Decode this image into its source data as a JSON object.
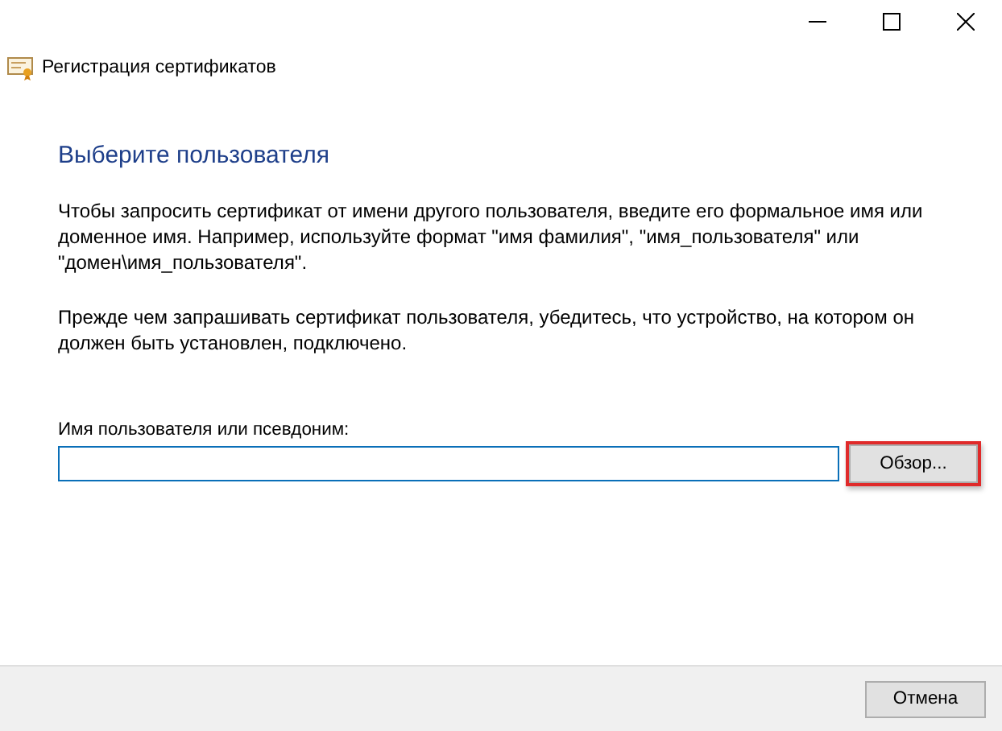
{
  "window": {
    "title": "Регистрация сертификатов"
  },
  "heading": "Выберите пользователя",
  "paragraphs": [
    "Чтобы запросить сертификат от имени другого пользователя, введите его формальное имя или доменное имя. Например, используйте формат \"имя фамилия\", \"имя_пользователя\" или \"домен\\имя_пользователя\".",
    "Прежде чем запрашивать сертификат пользователя, убедитесь, что устройство, на котором он должен быть установлен, подключено."
  ],
  "user_field": {
    "label": "Имя пользователя или псевдоним:",
    "focused": true
  },
  "browse_button": {
    "label": "Обзор...",
    "highlighted": true
  },
  "footer_buttons": [
    "Отмена"
  ]
}
